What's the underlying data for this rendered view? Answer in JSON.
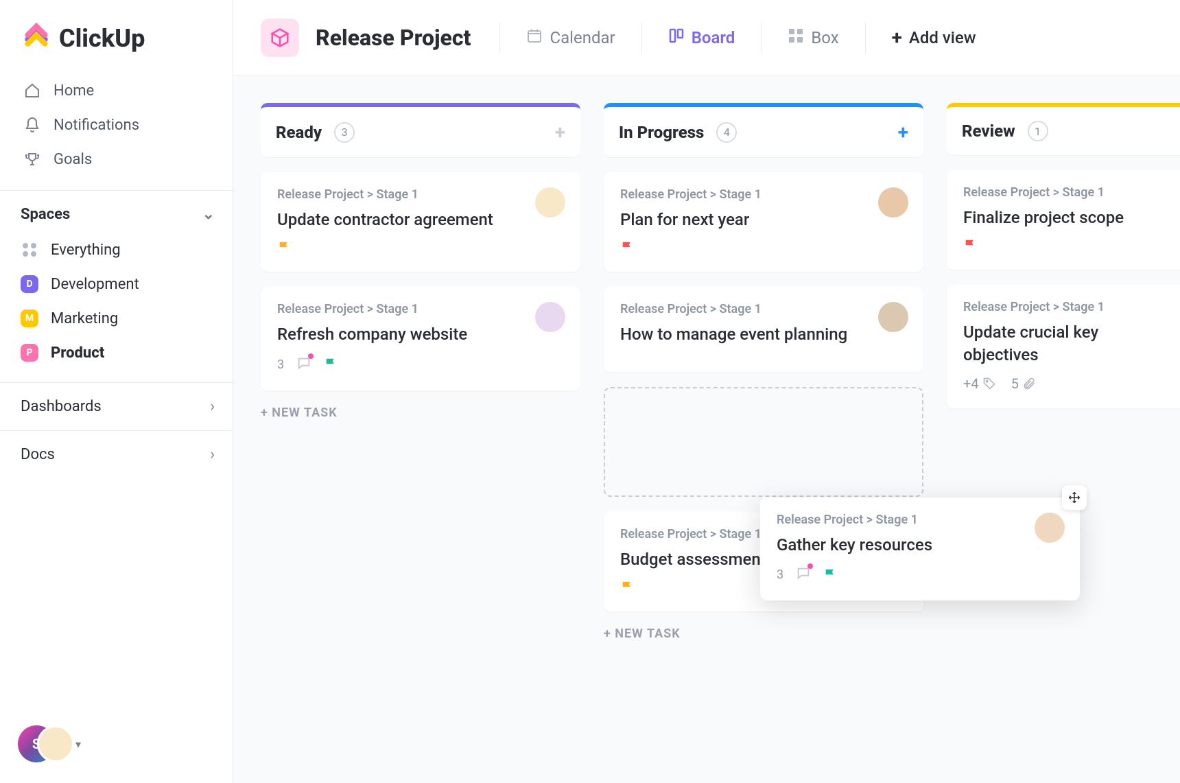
{
  "brand": "ClickUp",
  "nav": {
    "home": "Home",
    "notifications": "Notifications",
    "goals": "Goals"
  },
  "spaces": {
    "header": "Spaces",
    "everything": "Everything",
    "items": [
      {
        "letter": "D",
        "label": "Development",
        "color": "#7b68ee"
      },
      {
        "letter": "M",
        "label": "Marketing",
        "color": "#ffc800"
      },
      {
        "letter": "P",
        "label": "Product",
        "color": "#fd71af",
        "bold": true
      }
    ]
  },
  "sections": {
    "dashboards": "Dashboards",
    "docs": "Docs"
  },
  "profile_initial": "S",
  "header": {
    "title": "Release Project",
    "views": {
      "calendar": "Calendar",
      "board": "Board",
      "box": "Box",
      "add": "Add view"
    }
  },
  "columns": [
    {
      "id": "ready",
      "title": "Ready",
      "count": "3",
      "accent": "#7b68ee",
      "add_color": "#c8cdd6",
      "cards": [
        {
          "crumb": "Release Project > Stage 1",
          "title": "Update contractor agreement",
          "flag": "#ffb020",
          "av": "#f8e8c8"
        },
        {
          "crumb": "Release Project > Stage 1",
          "title": "Refresh company website",
          "flag": "#1abc9c",
          "av": "#e8d8f0",
          "comments": "3",
          "dot": true
        }
      ],
      "new_task": "+ NEW TASK"
    },
    {
      "id": "inprogress",
      "title": "In Progress",
      "count": "4",
      "accent": "#1e90ff",
      "add_color": "#1e90ff",
      "cards": [
        {
          "crumb": "Release Project > Stage 1",
          "title": "Plan for next year",
          "flag": "#ff5252",
          "av": "#e8c8a8"
        },
        {
          "crumb": "Release Project > Stage 1",
          "title": "How to manage event planning",
          "av": "#dac8b0"
        },
        {
          "slot": true
        },
        {
          "crumb": "Release Project > Stage 1",
          "title": "Budget assessment",
          "flag": "#ffb020"
        }
      ],
      "new_task": "+ NEW TASK"
    },
    {
      "id": "review",
      "title": "Review",
      "count": "1",
      "accent": "#ffc800",
      "add_color": "#c8cdd6",
      "partial": true,
      "cards": [
        {
          "crumb": "Release Project > Stage 1",
          "title": "Finalize project scope",
          "flag": "#ff5252"
        },
        {
          "crumb": "Release Project > Stage 1",
          "title": "Update crucial key objectives",
          "tags": "+4",
          "attach": "5"
        }
      ]
    }
  ],
  "floating_card": {
    "crumb": "Release Project > Stage 1",
    "title": "Gather key resources",
    "flag": "#1abc9c",
    "av": "#f0d8c0",
    "comments": "3"
  }
}
